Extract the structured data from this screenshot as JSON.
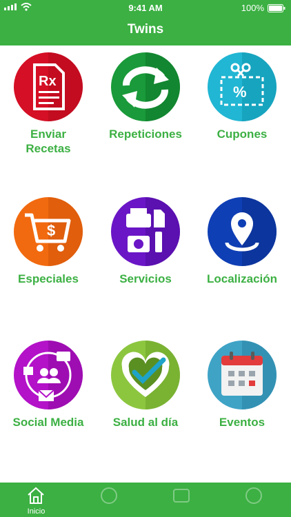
{
  "status_bar": {
    "time": "9:41 AM",
    "battery": "100%"
  },
  "nav": {
    "title": "Twins"
  },
  "tiles": [
    {
      "label": "Enviar\nRecetas",
      "icon": "prescription-icon"
    },
    {
      "label": "Repeticiones",
      "icon": "refresh-icon"
    },
    {
      "label": "Cupones",
      "icon": "coupon-icon"
    },
    {
      "label": "Especiales",
      "icon": "shopping-cart-icon"
    },
    {
      "label": "Servicios",
      "icon": "services-icon"
    },
    {
      "label": "Localización",
      "icon": "location-pin-icon"
    },
    {
      "label": "Social Media",
      "icon": "social-media-icon"
    },
    {
      "label": "Salud al día",
      "icon": "heart-check-icon"
    },
    {
      "label": "Eventos",
      "icon": "calendar-icon"
    }
  ],
  "tabs": [
    {
      "label": "Inicio",
      "active": true
    },
    {
      "label": "",
      "active": false
    },
    {
      "label": "",
      "active": false
    },
    {
      "label": "",
      "active": false
    }
  ],
  "colors": {
    "brand_green": "#3cb043",
    "label_green": "#3cb043"
  }
}
